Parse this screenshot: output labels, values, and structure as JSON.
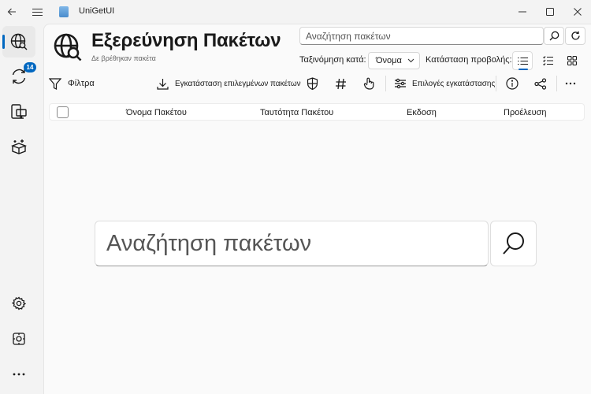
{
  "window": {
    "title": "UniGetUI",
    "back_icon": "arrow-left-icon",
    "menu_icon": "hamburger-icon",
    "controls": [
      "minimize-icon",
      "maximize-icon",
      "close-icon"
    ]
  },
  "sidebar": {
    "items": [
      {
        "icon": "globe-search-icon",
        "active": true
      },
      {
        "icon": "sync-icon",
        "badge": "14"
      },
      {
        "icon": "devices-icon"
      },
      {
        "icon": "package-sparkle-icon"
      }
    ],
    "bottom": [
      {
        "icon": "gear-icon"
      },
      {
        "icon": "settings-image-icon"
      },
      {
        "icon": "more-horizontal-icon",
        "label": "..."
      }
    ]
  },
  "header": {
    "title": "Εξερεύνηση Πακέτων",
    "subtitle": "Δε βρέθηκαν πακέτα",
    "search_placeholder": "Αναζήτηση πακέτων",
    "sort_label": "Ταξινόμηση κατά:",
    "sort_value": "Όνομα",
    "view_label": "Κατάσταση προβολής:"
  },
  "toolbar": {
    "filters_label": "Φίλτρα",
    "install_selected_label": "Εγκατάσταση επιλεγμένων πακέτων",
    "install_options_label": "Επιλογές εγκατάστασης"
  },
  "table": {
    "columns": [
      "Όνομα Πακέτου",
      "Ταυτότητα Πακέτου",
      "Εκδοση",
      "Προέλευση"
    ]
  },
  "main_search": {
    "placeholder": "Αναζήτηση πακέτων"
  },
  "colors": {
    "accent": "#0067c0",
    "window_bg": "#f3f3f3",
    "panel_bg": "#fafafa"
  }
}
